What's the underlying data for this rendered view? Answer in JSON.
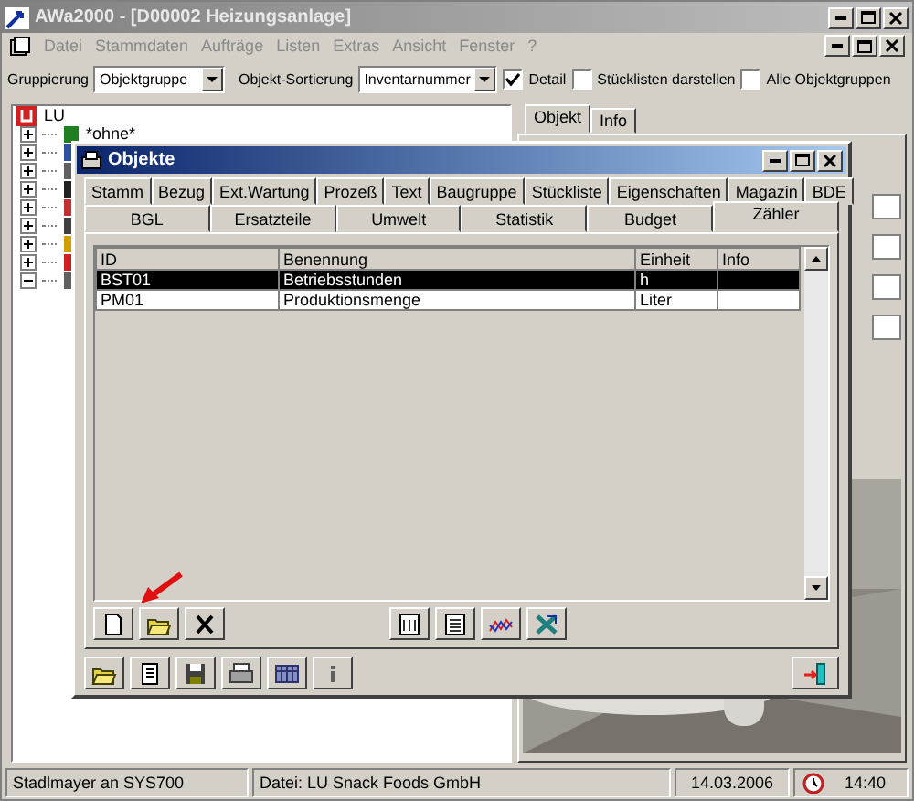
{
  "window": {
    "title": "AWa2000 - [D00002 Heizungsanlage]"
  },
  "menu": [
    "Datei",
    "Stammdaten",
    "Aufträge",
    "Listen",
    "Extras",
    "Ansicht",
    "Fenster",
    "?"
  ],
  "toolbar": {
    "grouping_label": "Gruppierung",
    "grouping_value": "Objektgruppe",
    "sort_label": "Objekt-Sortierung",
    "sort_value": "Inventarnummer",
    "checkboxes": [
      {
        "label": "Detail",
        "checked": true
      },
      {
        "label": "Stücklisten darstellen",
        "checked": false
      },
      {
        "label": "Alle Objektgruppen",
        "checked": false
      }
    ]
  },
  "tree": {
    "label": "LU",
    "children": [
      {
        "label": "*ohne*",
        "expanded": false
      },
      {
        "expanded": false
      },
      {
        "expanded": false
      },
      {
        "expanded": false
      },
      {
        "expanded": false
      },
      {
        "expanded": false
      },
      {
        "expanded": false
      },
      {
        "expanded": false
      },
      {
        "expanded": true
      }
    ]
  },
  "detail_tabs": [
    {
      "label": "Objekt",
      "selected": true
    },
    {
      "label": "Info",
      "selected": false
    }
  ],
  "dialog": {
    "title": "Objekte",
    "tab_rows": [
      [
        {
          "label": "Stamm",
          "selected": false
        },
        {
          "label": "Bezug",
          "selected": false
        },
        {
          "label": "Ext.Wartung",
          "selected": false
        },
        {
          "label": "Prozeß",
          "selected": false
        },
        {
          "label": "Text",
          "selected": false
        },
        {
          "label": "Baugruppe",
          "selected": false
        },
        {
          "label": "Stückliste",
          "selected": false
        },
        {
          "label": "Eigenschaften",
          "selected": false
        },
        {
          "label": "Magazin",
          "selected": false
        },
        {
          "label": "BDE",
          "selected": false
        }
      ],
      [
        {
          "label": "BGL",
          "selected": false
        },
        {
          "label": "Ersatzteile",
          "selected": false
        },
        {
          "label": "Umwelt",
          "selected": false
        },
        {
          "label": "Statistik",
          "selected": false
        },
        {
          "label": "Budget",
          "selected": false
        },
        {
          "label": "Zähler",
          "selected": true
        }
      ]
    ],
    "table": {
      "columns": [
        "ID",
        "Benennung",
        "Einheit",
        "Info"
      ],
      "rows": [
        {
          "cells": [
            "BST01",
            "Betriebsstunden",
            "h",
            ""
          ],
          "selected": true
        },
        {
          "cells": [
            "PM01",
            "Produktionsmenge",
            "Liter",
            ""
          ],
          "selected": false
        }
      ]
    }
  },
  "status_bar": {
    "user": "Stadlmayer an SYS700",
    "file": "Datei: LU Snack Foods GmbH",
    "date": "14.03.2006",
    "time": "14:40"
  }
}
